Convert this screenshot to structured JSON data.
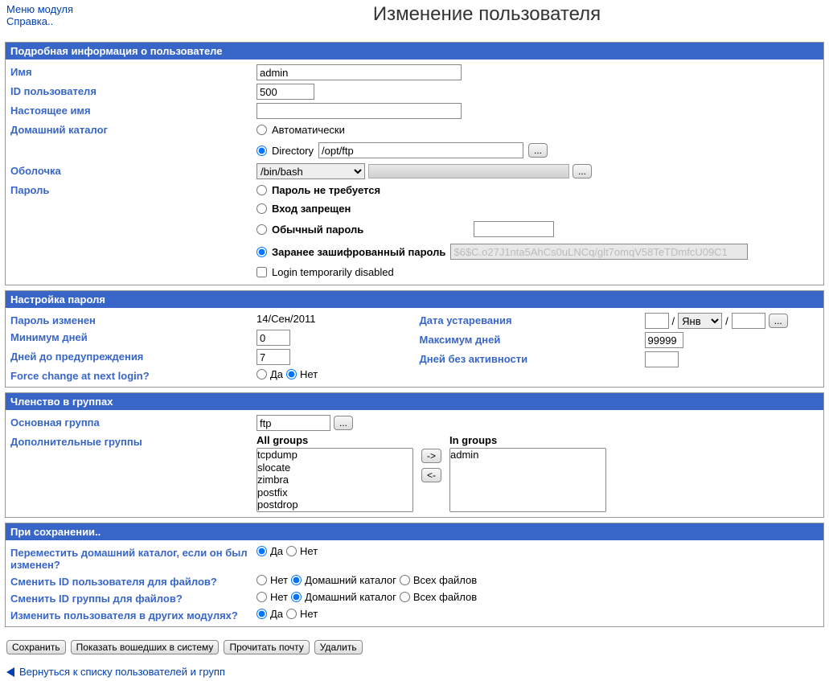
{
  "nav": {
    "module_menu": "Меню модуля",
    "help": "Справка.."
  },
  "title": "Изменение пользователя",
  "sections": {
    "details": "Подробная информация о пользователе",
    "password": "Настройка пароля",
    "groups": "Членство в группах",
    "onsave": "При сохранении.."
  },
  "labels": {
    "name": "Имя",
    "uid": "ID пользователя",
    "realname": "Настоящее имя",
    "homedir": "Домашний каталог",
    "shell": "Оболочка",
    "password": "Пароль",
    "homedir_auto": "Автоматически",
    "homedir_directory": "Directory",
    "pw_none": "Пароль не требуется",
    "pw_nologin": "Вход запрещен",
    "pw_normal": "Обычный пароль",
    "pw_preenc": "Заранее зашифрованный пароль",
    "pw_templock": "Login temporarily disabled",
    "pw_changed": "Пароль изменен",
    "pw_expire": "Дата устаревания",
    "pw_min": "Минимум дней",
    "pw_max": "Максимум дней",
    "pw_warn": "Дней до предупреждения",
    "pw_inactive": "Дней без активности",
    "pw_force": "Force change at next login?",
    "yes": "Да",
    "no": "Нет",
    "primary": "Основная группа",
    "secondary": "Дополнительные группы",
    "allgroups": "All groups",
    "ingroups": "In groups",
    "movehome": "Переместить домашний каталог, если он был изменен?",
    "chuid": "Сменить ID пользователя для файлов?",
    "chgid": "Сменить ID группы для файлов?",
    "others": "Изменить пользователя в других модулях?",
    "opt_no": "Нет",
    "opt_home": "Домашний каталог",
    "opt_all": "Всех файлов",
    "browse": "...",
    "move_right": "->",
    "move_left": "<-"
  },
  "values": {
    "name": "admin",
    "uid": "500",
    "realname": "",
    "homedir": "/opt/ftp",
    "shell": "/bin/bash",
    "preenc": "$6$C.o27J1nta5AhCs0uLNCq/glt7omqV58TeTDmfcU09C1",
    "pw_changed": "14/Сен/2011",
    "min": "0",
    "max": "99999",
    "warn": "7",
    "inactive": "",
    "primary": "ftp",
    "month": "Янв",
    "allg0": "tcpdump",
    "allg1": "slocate",
    "allg2": "zimbra",
    "allg3": "postfix",
    "allg4": "postdrop",
    "ing0": "admin"
  },
  "actions": {
    "save": "Сохранить",
    "logins": "Показать вошедших в систему",
    "mail": "Прочитать почту",
    "delete": "Удалить"
  },
  "back": "Вернуться к списку пользователей и групп"
}
